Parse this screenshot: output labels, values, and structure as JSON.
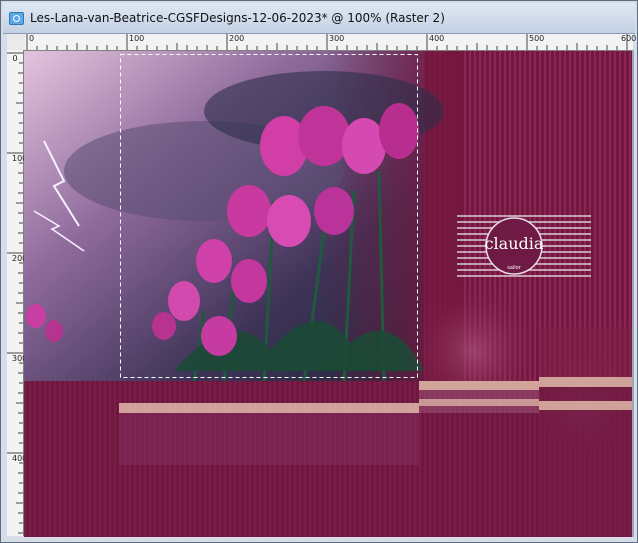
{
  "window": {
    "title": "Les-Lana-van-Beatrice-CGSFDesigns-12-06-2023* @ 100% (Raster 2)"
  },
  "ruler": {
    "top_labels": [
      "0",
      "100",
      "200",
      "300",
      "400",
      "500",
      "600"
    ],
    "left_labels": [
      "0",
      "100",
      "200",
      "300",
      "400"
    ]
  },
  "canvas": {
    "watermark_text": "claudia",
    "watermark_subtext": "sailor"
  },
  "colors": {
    "background": "#74173f",
    "stripe": "#8a2656",
    "band": "#d9b0a3",
    "tulip": "#d13fa6",
    "sky": "#7a5a8a"
  }
}
